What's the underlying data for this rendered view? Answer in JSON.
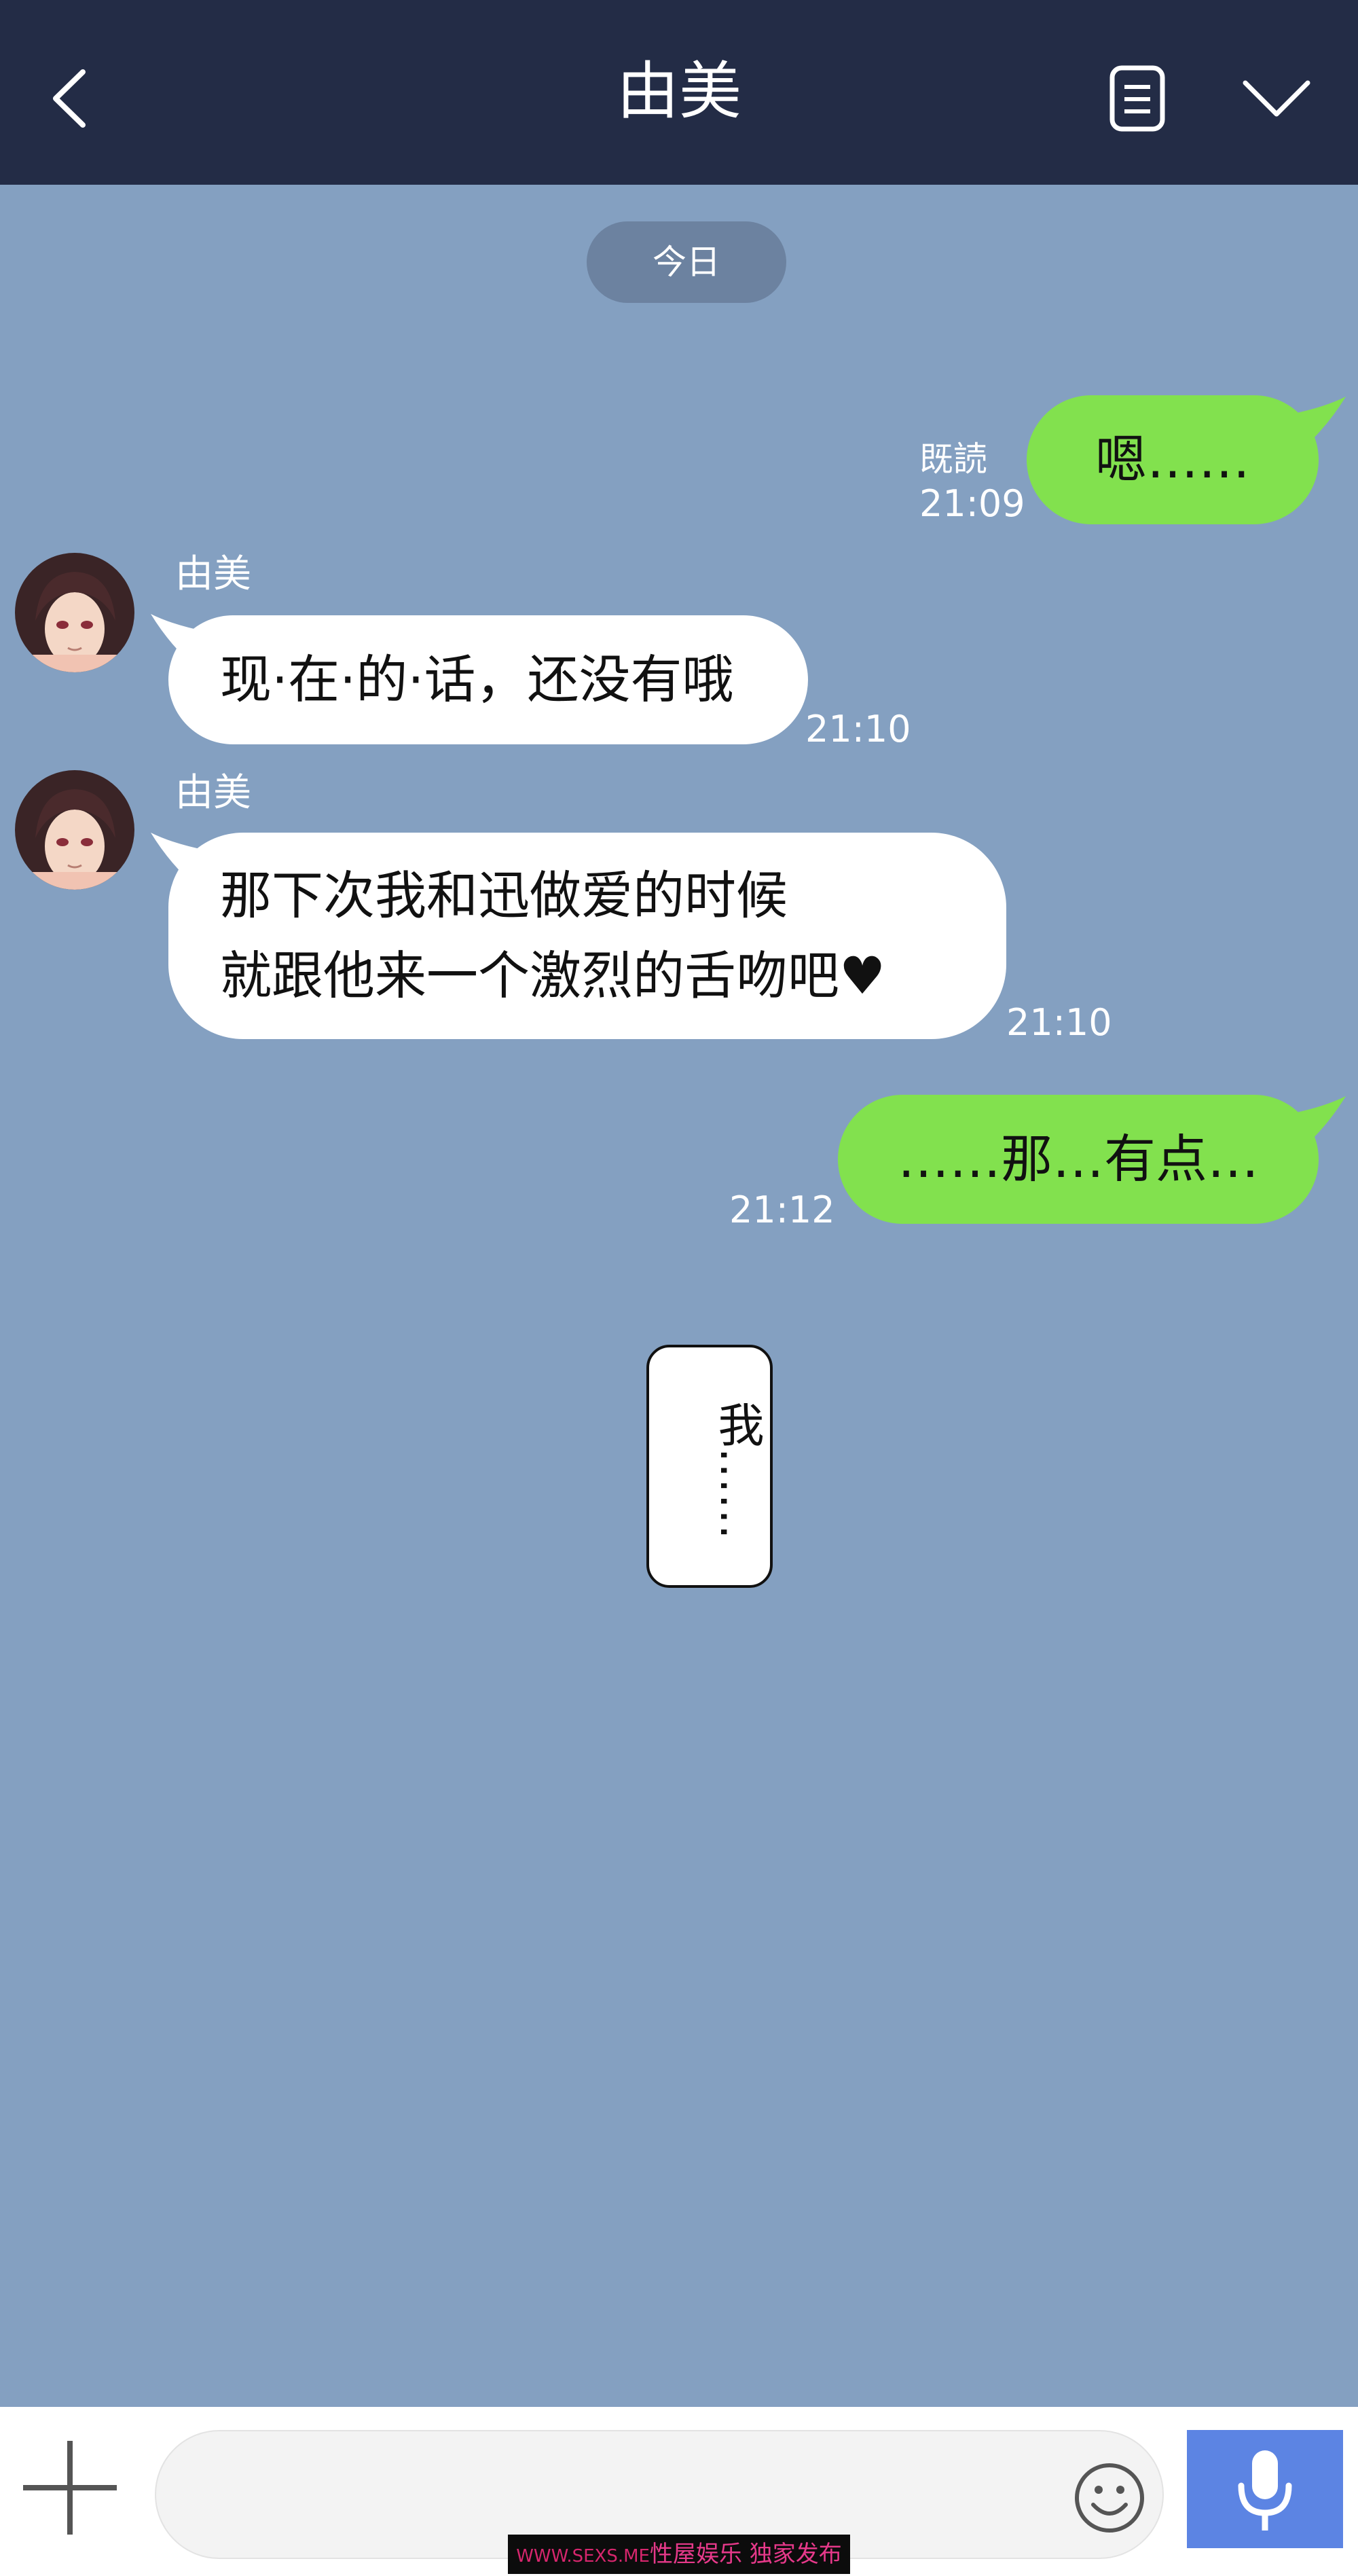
{
  "header": {
    "title": "由美",
    "back_icon": "chevron-left-icon",
    "notes_icon": "document-icon",
    "menu_icon": "chevron-down-icon"
  },
  "date_divider": "今日",
  "messages": [
    {
      "direction": "outgoing",
      "text": "嗯……",
      "read_status": "既読",
      "time": "21:09"
    },
    {
      "direction": "incoming",
      "sender": "由美",
      "text": "现·在·的·话，还没有哦",
      "time": "21:10"
    },
    {
      "direction": "incoming",
      "sender": "由美",
      "lines": [
        "那下次我和迅做爱的时候",
        "就跟他来一个激烈的舌吻吧♥"
      ],
      "time": "21:10"
    },
    {
      "direction": "outgoing",
      "text": "……那…有点…",
      "time": "21:12"
    }
  ],
  "thought": "我……",
  "input_bar": {
    "placeholder": "",
    "plus_icon": "plus-icon",
    "emoji_icon": "smiley-icon",
    "mic_icon": "microphone-icon"
  },
  "watermark": {
    "url": "WWW.SEXS.ME",
    "slogan": "性屋娱乐 独家发布"
  },
  "colors": {
    "header_bg": "#232c46",
    "chat_bg": "#84a0c1",
    "outgoing_bubble": "#82e14e",
    "incoming_bubble": "#ffffff",
    "mic_button": "#5c84e3",
    "date_pill": "#6c82a0"
  }
}
